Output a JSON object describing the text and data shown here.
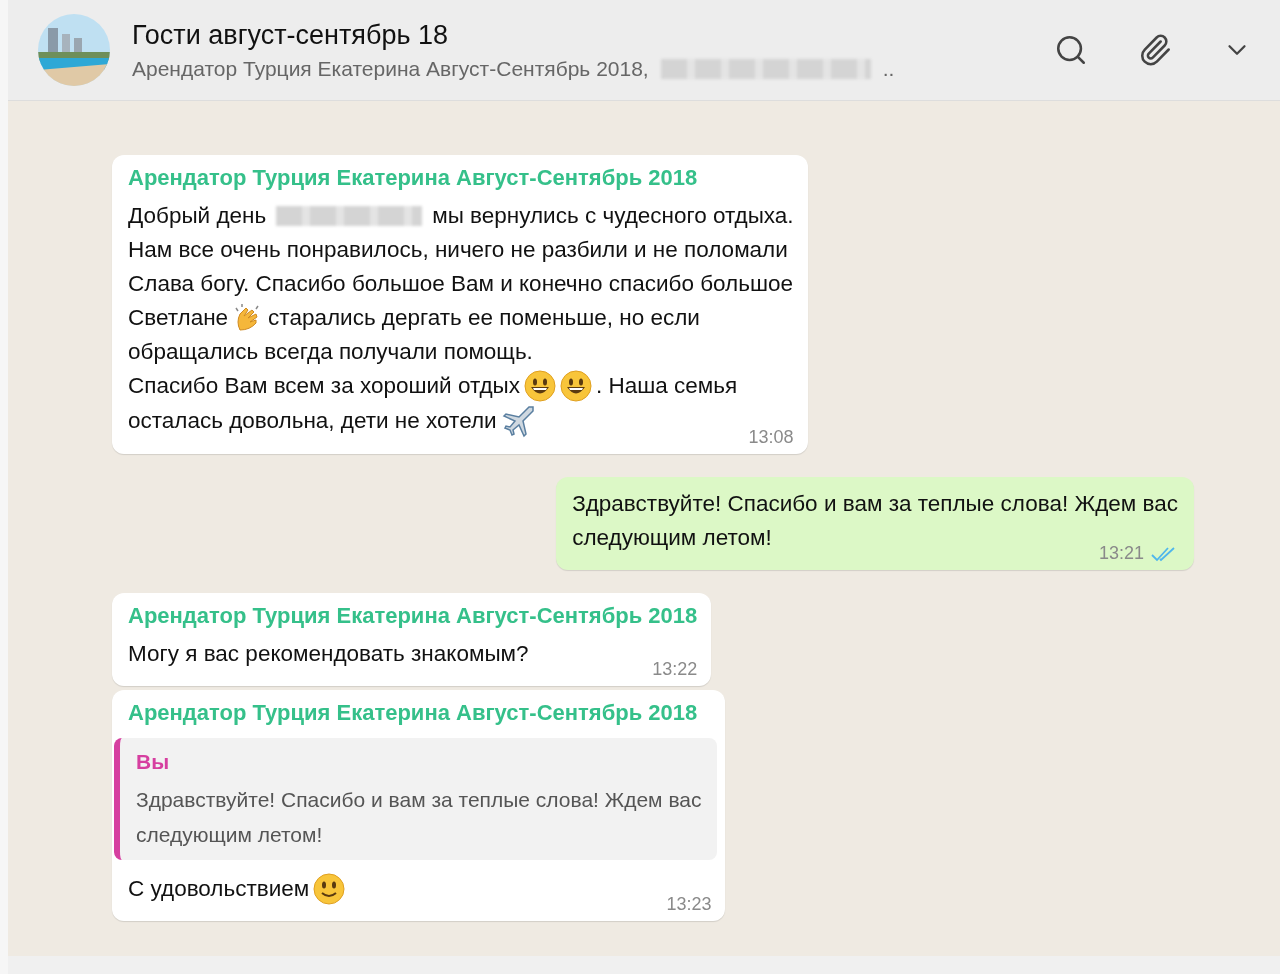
{
  "header": {
    "title": "Гости август-сентябрь 18",
    "subtitle": "Арендатор Турция Екатерина Август-Сентябрь 2018,",
    "subtitle_redacted": true,
    "subtitle_end": ".."
  },
  "messages": [
    {
      "outgoing": false,
      "sender": "Арендатор Турция Екатерина Август-Сентябрь 2018",
      "lines": [
        [
          {
            "kind": "text",
            "text": "Добрый день"
          },
          {
            "kind": "redacted"
          },
          {
            "kind": "text",
            "text": "мы вернулись с чудесного отдыха."
          }
        ],
        [
          {
            "kind": "text",
            "text": "Нам все очень понравилось, ничего не разбили и не поломали"
          }
        ],
        [
          {
            "kind": "text",
            "text": "Слава богу. Спасибо большое Вам и конечно спасибо большое"
          }
        ],
        [
          {
            "kind": "text",
            "text": "Светлане"
          },
          {
            "kind": "clap"
          },
          {
            "kind": "text",
            "text": "старались дергать ее поменьше, но если"
          }
        ],
        [
          {
            "kind": "text",
            "text": "обращались всегда получали помощь."
          }
        ],
        [
          {
            "kind": "text",
            "text": "Спасибо Вам всем за хороший отдых"
          },
          {
            "kind": "smile"
          },
          {
            "kind": "smile"
          },
          {
            "kind": "text",
            "text": ". Наша семья"
          }
        ],
        [
          {
            "kind": "text",
            "text": "осталась довольна, дети не хотели"
          },
          {
            "kind": "plane"
          }
        ]
      ],
      "time": "13:08"
    },
    {
      "outgoing": true,
      "lines": [
        [
          {
            "kind": "text",
            "text": "Здравствуйте! Спасибо и вам за теплые слова! Ждем вас"
          }
        ],
        [
          {
            "kind": "text",
            "text": "следующим летом!"
          }
        ]
      ],
      "time": "13:21",
      "read": true
    },
    {
      "outgoing": false,
      "sender": "Арендатор Турция Екатерина Август-Сентябрь 2018",
      "lines": [
        [
          {
            "kind": "text",
            "text": "Могу я вас рекомендовать знакомым?"
          }
        ]
      ],
      "time": "13:22"
    },
    {
      "outgoing": false,
      "sender": "Арендатор Турция Екатерина Август-Сентябрь 2018",
      "quote": {
        "author": "Вы",
        "lines": [
          "Здравствуйте! Спасибо и вам за теплые слова! Ждем вас",
          "следующим летом!"
        ]
      },
      "lines": [
        [
          {
            "kind": "text",
            "text": "С удовольствием"
          },
          {
            "kind": "slight"
          }
        ]
      ],
      "time": "13:23"
    }
  ]
}
